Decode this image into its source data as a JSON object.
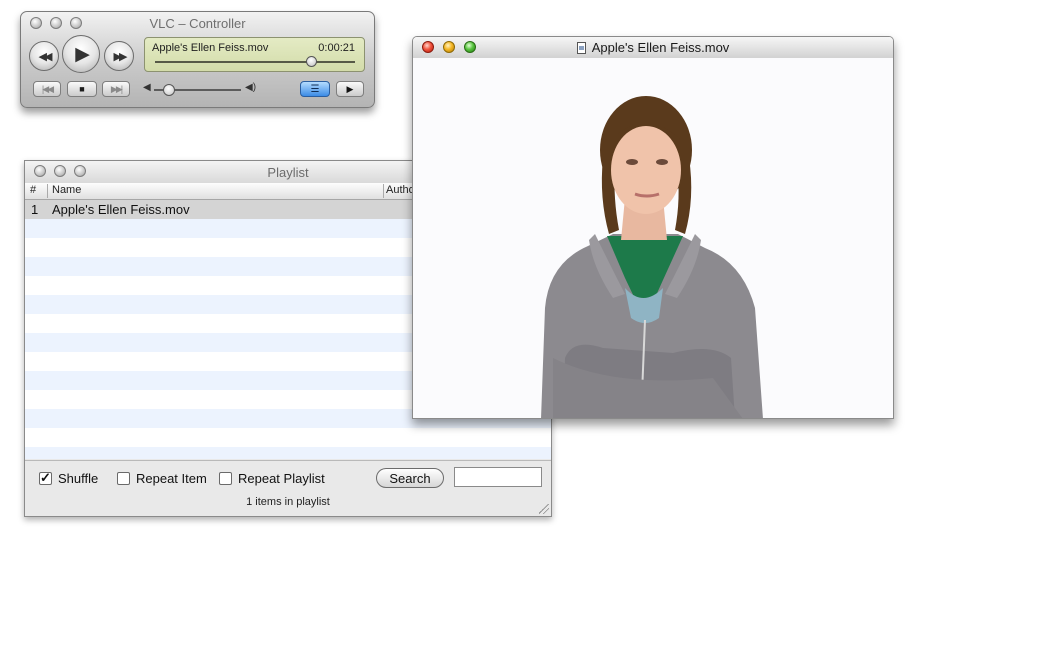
{
  "controller": {
    "title": "VLC – Controller",
    "now_playing": "Apple's Ellen Feiss.mov",
    "elapsed": "0:00:21",
    "seek_position": 0.78,
    "volume_level": 0.17,
    "icons": {
      "rewind": "rewind-icon",
      "play": "play-icon",
      "fast_forward": "fast-forward-icon",
      "previous": "previous-icon",
      "stop": "stop-icon",
      "next": "next-icon",
      "volume_min": "speaker-low-icon",
      "volume_max": "speaker-high-icon",
      "playlist": "playlist-icon",
      "fullscreen": "fullscreen-icon"
    },
    "accent_color": "#3c8ce6",
    "lcd_color": "#d9e1b4"
  },
  "playlist": {
    "title": "Playlist",
    "columns": [
      "#",
      "Name",
      "Autho"
    ],
    "items": [
      {
        "num": "1",
        "name": "Apple's Ellen Feiss.mov"
      }
    ],
    "shuffle_label": "Shuffle",
    "shuffle_checked": true,
    "repeat_item_label": "Repeat Item",
    "repeat_item_checked": false,
    "repeat_playlist_label": "Repeat Playlist",
    "repeat_playlist_checked": false,
    "search_label": "Search",
    "search_value": "",
    "count_text": "1 items in playlist"
  },
  "video": {
    "title": "Apple's Ellen Feiss.mov"
  }
}
